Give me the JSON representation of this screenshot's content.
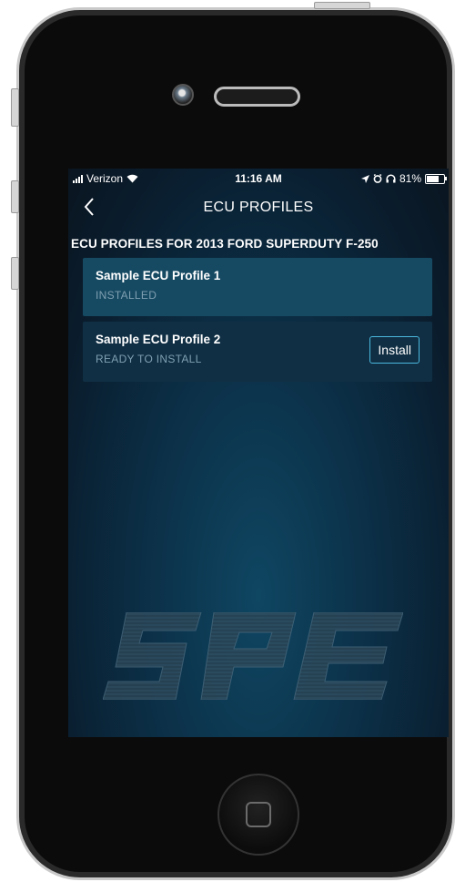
{
  "status_bar": {
    "carrier": "Verizon",
    "time": "11:16 AM",
    "battery": "81%",
    "battery_level": 0.81
  },
  "nav": {
    "title": "ECU PROFILES",
    "back_icon": "chevron-left-icon"
  },
  "section_title": "ECU PROFILES FOR 2013 FORD SUPERDUTY F-250",
  "profiles": [
    {
      "name": "Sample ECU Profile 1",
      "status": "INSTALLED"
    },
    {
      "name": "Sample ECU Profile 2",
      "status": "READY TO INSTALL",
      "action": "Install"
    }
  ],
  "watermark": "SPE",
  "colors": {
    "accent": "#4bb8de",
    "card_installed": "#164a63",
    "card_ready": "#102f44"
  }
}
